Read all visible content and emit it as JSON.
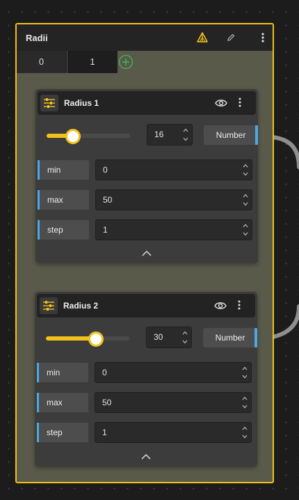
{
  "group": {
    "title": "Radii",
    "tabs": [
      "0",
      "1"
    ],
    "active_tab": "1"
  },
  "nodes": [
    {
      "title": "Radius 1",
      "value": "16",
      "slider_fraction": 0.32,
      "output_label": "Number",
      "fields": [
        {
          "label": "min",
          "value": "0"
        },
        {
          "label": "max",
          "value": "50"
        },
        {
          "label": "step",
          "value": "1"
        }
      ]
    },
    {
      "title": "Radius 2",
      "value": "30",
      "slider_fraction": 0.6,
      "output_label": "Number",
      "fields": [
        {
          "label": "min",
          "value": "0"
        },
        {
          "label": "max",
          "value": "50"
        },
        {
          "label": "step",
          "value": "1"
        }
      ]
    }
  ],
  "colors": {
    "accent": "#f2c21a",
    "port": "#4aa8e6",
    "add": "#3cb85a"
  },
  "icons": [
    "warning-icon",
    "pencil-icon",
    "more-vertical-icon",
    "add-tab-icon",
    "sliders-icon",
    "eye-icon",
    "chevron-up-icon",
    "chevron-down-icon"
  ]
}
